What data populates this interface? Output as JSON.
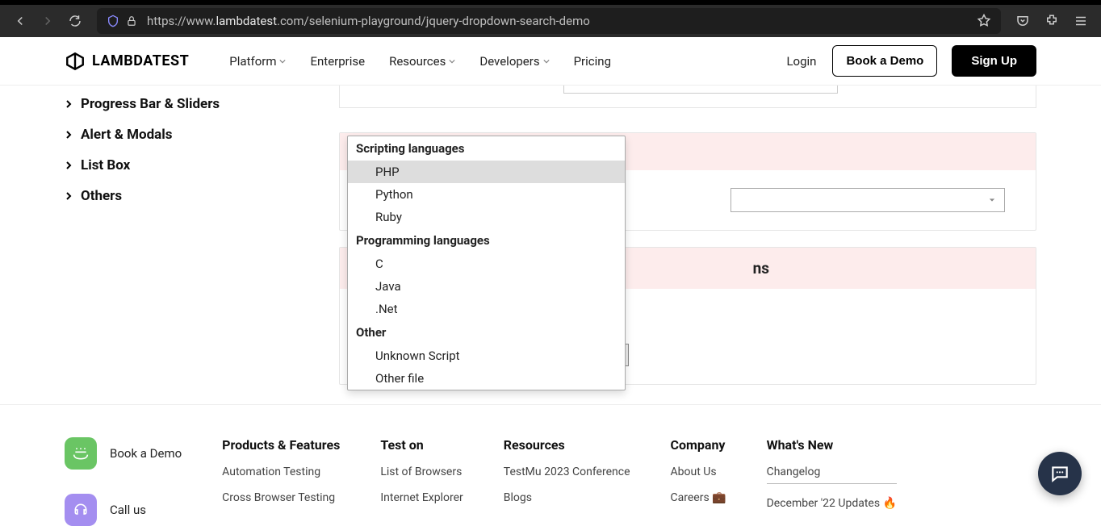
{
  "browser": {
    "url_prefix": "https://www.",
    "url_host": "lambdatest",
    "url_path": ".com/selenium-playground/jquery-dropdown-search-demo"
  },
  "header": {
    "logo": "LAMBDATEST",
    "nav": {
      "platform": "Platform",
      "enterprise": "Enterprise",
      "resources": "Resources",
      "developers": "Developers",
      "pricing": "Pricing"
    },
    "login": "Login",
    "book_demo": "Book a Demo",
    "sign_up": "Sign Up"
  },
  "sidebar": {
    "items": [
      {
        "label": "Progress Bar & Sliders"
      },
      {
        "label": "Alert & Modals"
      },
      {
        "label": "List Box"
      },
      {
        "label": "Others"
      }
    ]
  },
  "dropdown": {
    "group1_label": "Scripting languages",
    "group1_options": [
      "PHP",
      "Python",
      "Ruby"
    ],
    "group2_label": "Programming languages",
    "group2_options": [
      "C",
      "Java",
      ".Net"
    ],
    "group3_label": "Other",
    "group3_options": [
      "Unknown Script",
      "Other file"
    ],
    "selected_display": "PHP"
  },
  "card_disabled": {
    "title_suffix": "ns"
  },
  "footer": {
    "cta_demo": "Book a Demo",
    "cta_call": "Call us",
    "col1": {
      "h": "Products & Features",
      "l1": "Automation Testing",
      "l2": "Cross Browser Testing"
    },
    "col2": {
      "h": "Test on",
      "l1": "List of Browsers",
      "l2": "Internet Explorer"
    },
    "col3": {
      "h": "Resources",
      "l1": "TestMu 2023 Conference",
      "l2": "Blogs"
    },
    "col4": {
      "h": "Company",
      "l1": "About Us",
      "l2": "Careers 💼"
    },
    "col5": {
      "h": "What's New",
      "l1": "Changelog",
      "l2": "December '22 Updates 🔥"
    }
  }
}
